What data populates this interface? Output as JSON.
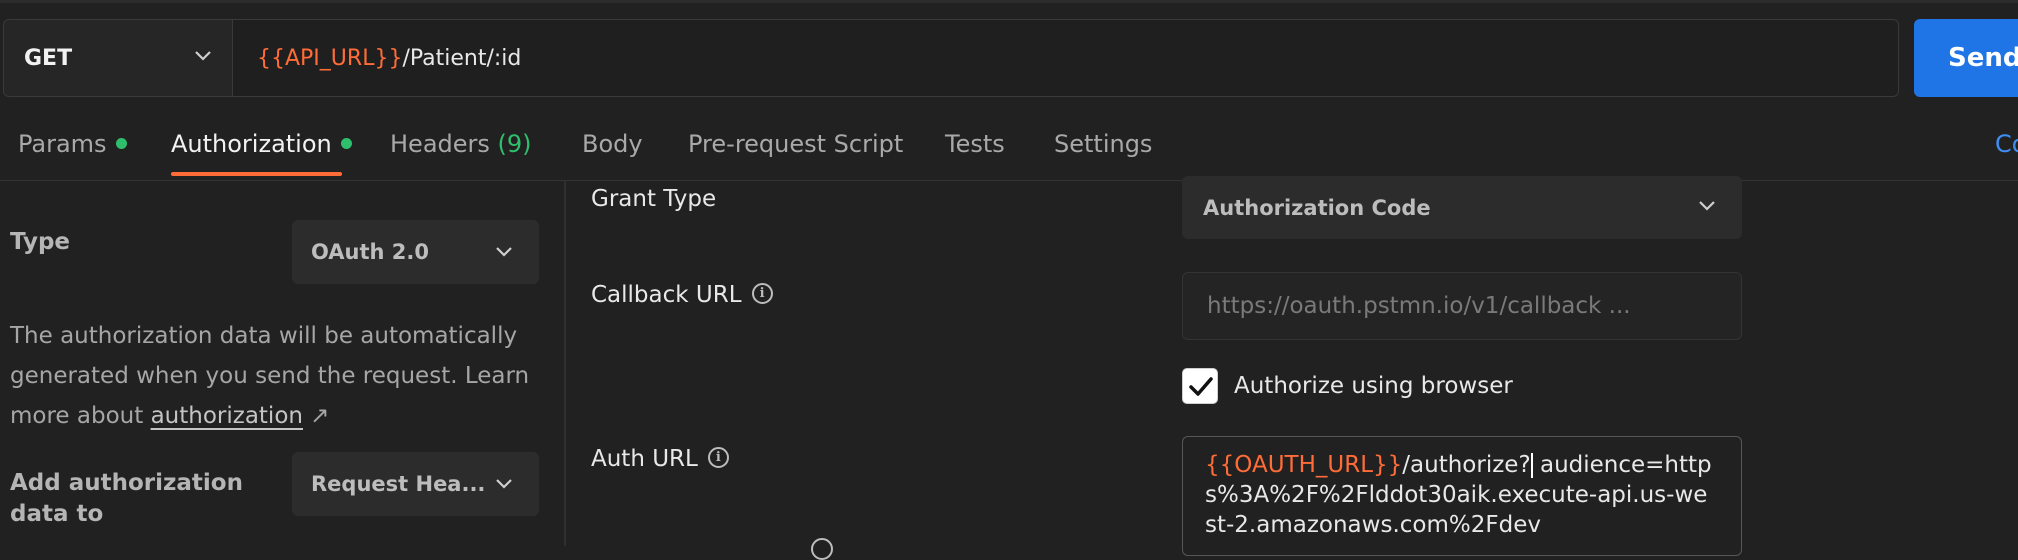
{
  "request": {
    "method": "GET",
    "url_var": "{{API_URL}}",
    "url_path": "/Patient/:id",
    "send_label": "Send"
  },
  "tabs": [
    {
      "label": "Params",
      "dot": true
    },
    {
      "label": "Authorization",
      "dot": true,
      "active": true
    },
    {
      "label": "Headers",
      "count": "(9)"
    },
    {
      "label": "Body"
    },
    {
      "label": "Pre-request Script"
    },
    {
      "label": "Tests"
    },
    {
      "label": "Settings"
    }
  ],
  "cookies_label": "Co",
  "auth": {
    "type_label": "Type",
    "type_value": "OAuth 2.0",
    "description": "The authorization data will be automatically generated when you send the request. Learn more about",
    "learn_link": "authorization",
    "link_arrow": "↗",
    "add_to_label": "Add authorization data to",
    "add_to_value": "Request Hea..."
  },
  "config": {
    "grant_type_label": "Grant Type",
    "grant_type_value": "Authorization Code",
    "callback_label": "Callback URL",
    "callback_placeholder": "https://oauth.pstmn.io/v1/callback ...",
    "authorize_browser_label": "Authorize using browser",
    "authorize_browser_checked": true,
    "auth_url_label": "Auth URL",
    "auth_url_var": "{{OAUTH_URL}}",
    "auth_url_rest": "/authorize?",
    "auth_url_query": "audience=https%3A%2F%2Flddot30aik.execute-api.us-west-2.amazonaws.com%2Fdev"
  },
  "colors": {
    "accent": "#ff6c37",
    "send_blue": "#1f75e6",
    "status_green": "#2fbf6c"
  },
  "icons": {
    "chevron": "chevron-down-icon",
    "info": "info-icon",
    "check": "checkmark-icon"
  }
}
